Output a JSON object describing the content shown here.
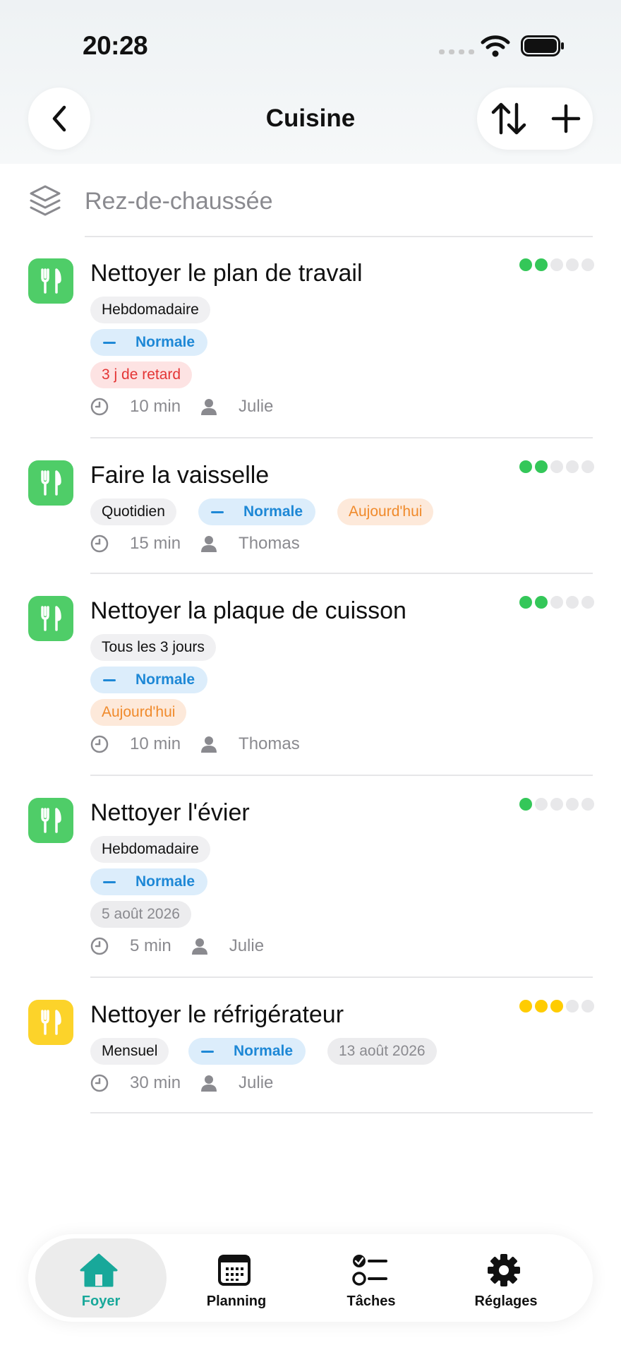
{
  "status_bar": {
    "time": "20:28"
  },
  "nav": {
    "title": "Cuisine"
  },
  "section": {
    "label": "Rez-de-chaussée"
  },
  "tasks": [
    {
      "title": "Nettoyer le plan de travail",
      "icon_color": "#4fcd68",
      "difficulty": {
        "filled": 2,
        "total": 5,
        "color": "#34c759"
      },
      "frequency": "Hebdomadaire",
      "priority": "Normale",
      "status": "3 j de retard",
      "duration": "10 min",
      "assignee": "Julie"
    },
    {
      "title": "Faire la vaisselle",
      "icon_color": "#4fcd68",
      "difficulty": {
        "filled": 2,
        "total": 5,
        "color": "#34c759"
      },
      "frequency": "Quotidien",
      "priority": "Normale",
      "status": "Aujourd'hui",
      "duration": "15 min",
      "assignee": "Thomas"
    },
    {
      "title": "Nettoyer la plaque de cuisson",
      "icon_color": "#4fcd68",
      "difficulty": {
        "filled": 2,
        "total": 5,
        "color": "#34c759"
      },
      "frequency": "Tous les 3 jours",
      "priority": "Normale",
      "status": "Aujourd'hui",
      "duration": "10 min",
      "assignee": "Thomas"
    },
    {
      "title": "Nettoyer l'évier",
      "icon_color": "#4fcd68",
      "difficulty": {
        "filled": 1,
        "total": 5,
        "color": "#34c759"
      },
      "frequency": "Hebdomadaire",
      "priority": "Normale",
      "status": "5 août 2026",
      "duration": "5 min",
      "assignee": "Julie"
    },
    {
      "title": "Nettoyer le réfrigérateur",
      "icon_color": "#fcd32a",
      "difficulty": {
        "filled": 3,
        "total": 5,
        "color": "#ffcc00"
      },
      "frequency": "Mensuel",
      "priority": "Normale",
      "status": "13 août 2026",
      "duration": "30 min",
      "assignee": "Julie"
    }
  ],
  "tab_bar": {
    "tabs": [
      {
        "label": "Foyer",
        "icon": "home-icon",
        "active": true
      },
      {
        "label": "Planning",
        "icon": "calendar-icon",
        "active": false
      },
      {
        "label": "Tâches",
        "icon": "checklist-icon",
        "active": false
      },
      {
        "label": "Réglages",
        "icon": "gear-icon",
        "active": false
      }
    ]
  },
  "colors": {
    "accent": "#18a89a",
    "priority_blue": "#1e88d6",
    "overdue_red": "#e43535",
    "today_orange": "#f08a2b"
  }
}
